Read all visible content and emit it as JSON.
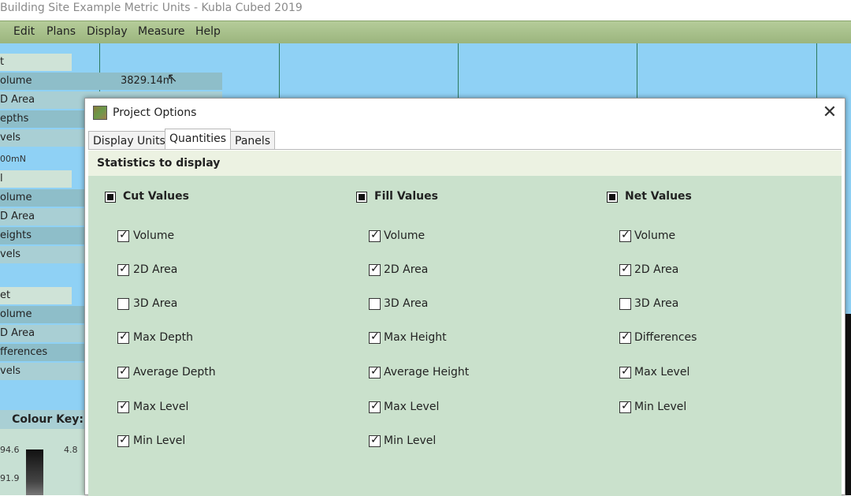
{
  "window": {
    "title": "Building Site Example Metric Units - Kubla Cubed 2019",
    "menu": [
      "Edit",
      "Plans",
      "Display",
      "Measure",
      "Help"
    ]
  },
  "left_panel": {
    "rows": [
      "t",
      "olume",
      "D Area",
      "epths",
      "vels",
      "00mN",
      "l",
      "olume",
      "D Area",
      "eights",
      "vels",
      "et",
      "olume",
      "D Area",
      "fferences",
      "vels"
    ],
    "volume_value": "3829.14m",
    "colour_key": {
      "title": "Colour Key:",
      "labels": [
        "94.6",
        "4.8",
        "91.9"
      ]
    }
  },
  "dialog": {
    "title": "Project Options",
    "tabs": [
      "Display Units",
      "Quantities",
      "Panels"
    ],
    "active_tab": "Quantities",
    "section_title": "Statistics to display",
    "groups": [
      {
        "name": "Cut Values",
        "items": [
          {
            "label": "Volume",
            "checked": true
          },
          {
            "label": "2D Area",
            "checked": true
          },
          {
            "label": "3D Area",
            "checked": false
          },
          {
            "label": "Max Depth",
            "checked": true
          },
          {
            "label": "Average Depth",
            "checked": true
          },
          {
            "label": "Max Level",
            "checked": true
          },
          {
            "label": "Min Level",
            "checked": true
          }
        ]
      },
      {
        "name": "Fill Values",
        "items": [
          {
            "label": "Volume",
            "checked": true
          },
          {
            "label": "2D Area",
            "checked": true
          },
          {
            "label": "3D Area",
            "checked": false
          },
          {
            "label": "Max Height",
            "checked": true
          },
          {
            "label": "Average Height",
            "checked": true
          },
          {
            "label": "Max Level",
            "checked": true
          },
          {
            "label": "Min Level",
            "checked": true
          }
        ]
      },
      {
        "name": "Net Values",
        "items": [
          {
            "label": "Volume",
            "checked": true
          },
          {
            "label": "2D Area",
            "checked": true
          },
          {
            "label": "3D Area",
            "checked": false
          },
          {
            "label": "Differences",
            "checked": true
          },
          {
            "label": "Max Level",
            "checked": true
          },
          {
            "label": "Min Level",
            "checked": true
          }
        ]
      }
    ]
  }
}
